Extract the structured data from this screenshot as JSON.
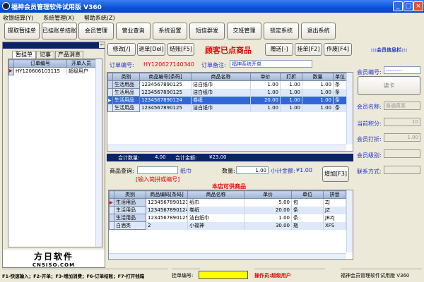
{
  "window": {
    "title": "福神会员管理软件试用版 V360",
    "controls": [
      "_",
      "□",
      "×"
    ]
  },
  "menu": [
    "收银结算(Y)",
    "系统管理(X)",
    "帮助系统(Z)"
  ],
  "toolbar": [
    "提取暂挂单",
    "已挂账单结账",
    "会员管理",
    "营业查询",
    "系统设置",
    "短信群发",
    "交班管理",
    "锁定系统",
    "退出系统"
  ],
  "left": {
    "tabs": [
      "暂挂单",
      "记事",
      "产品消息"
    ],
    "columns": [
      "订单编号",
      "开单人员"
    ],
    "rows": [
      [
        "HY120606103115",
        "超级用户"
      ]
    ],
    "logo": {
      "cn": "方日软件",
      "en": "CNSISO.COM"
    }
  },
  "order": {
    "buttons": {
      "edit": "修改[/]",
      "refund": "退单[Del]",
      "checkout": "结账[F5]",
      "gift": "赠送[-]",
      "hang": "挂单[F2]",
      "void": "作废[F4]"
    },
    "heading": "顾客已点商品",
    "order_no_label": "订单编号:",
    "order_no": "HY120627140340",
    "remark_label": "订单备注:",
    "remark": "福神系统开单",
    "columns": [
      "类别",
      "商品编号[条码]",
      "商品名称",
      "单价",
      "打折",
      "数量",
      "单位"
    ],
    "rows": [
      [
        "生活用品",
        "1234567890125",
        "洁白纸巾",
        "1.00",
        "1.00",
        "1.00",
        "条"
      ],
      [
        "生活用品",
        "1234567890125",
        "洁白纸巾",
        "1.00",
        "1.00",
        "1.00",
        "条"
      ],
      [
        "生活用品",
        "1234567890124",
        "卷纸",
        "20.00",
        "1.00",
        "1.00",
        "条"
      ],
      [
        "生活用品",
        "1234567890125",
        "洁白纸巾",
        "1.00",
        "1.00",
        "1.00",
        "条"
      ]
    ],
    "selected_row": 2,
    "total_qty_label": "合计数量:",
    "total_qty": "4.00",
    "total_amt_label": "合计金额:",
    "total_amt": "¥23.00"
  },
  "query": {
    "label": "商品查询:",
    "value": "",
    "match": "纸巾",
    "hint": "[输入简拼或编号]",
    "qty_label": "数量:",
    "qty": "1.00",
    "subtotal_label": "小计金额:",
    "subtotal": "¥1.00",
    "add_button": "增加[F3]"
  },
  "products": {
    "heading": "本店可供商品",
    "columns": [
      "类别",
      "商品编码[条码]",
      "商品名称",
      "单价",
      "单位",
      "拼音"
    ],
    "rows": [
      [
        "生活用品",
        "1234567890123",
        "纸巾",
        "5.00",
        "包",
        "ZJ"
      ],
      [
        "生活用品",
        "1234567890124",
        "卷纸",
        "20.00",
        "条",
        "JZ"
      ],
      [
        "生活用品",
        "1234567890125",
        "洁白纸巾",
        "1.00",
        "条",
        "JBZJ"
      ],
      [
        "白酒类",
        "2",
        "小福神",
        "30.00",
        "瓶",
        "XFS"
      ]
    ]
  },
  "member": {
    "title": ":::会员信息栏:::",
    "id_label": "会员编号:",
    "id": "---------",
    "read_card": "读卡",
    "name_label": "会员名称:",
    "name": "普通真客",
    "points_label": "当前积分:",
    "points": "10",
    "discount_label": "会员打折:",
    "discount": "1.00",
    "level_label": "会员级别:",
    "level": "",
    "contact_label": "联系方式:",
    "contact": ""
  },
  "status": {
    "shortcuts": "F1-快速输入；F2-开单；F3-增加消费；F6-订单结账；F7-打开钱箱",
    "hang_label": "挂单编号:",
    "hang_value": "",
    "operator": "操作员:超级用户",
    "product": "福神会员管理软件试用版 V360"
  }
}
